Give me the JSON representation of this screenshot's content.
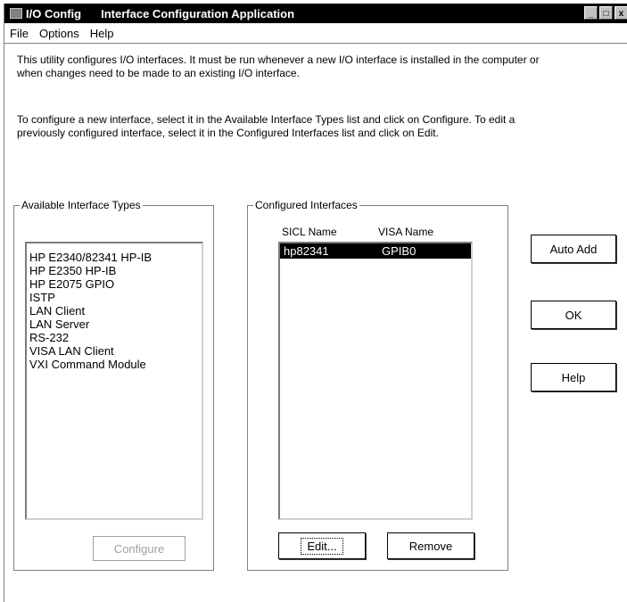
{
  "window": {
    "title_app": "I/O Config",
    "title_desc": "Interface Configuration Application",
    "controls": {
      "minimize": "_",
      "maximize": "□",
      "close": "x"
    }
  },
  "menu": [
    "File",
    "Options",
    "Help"
  ],
  "description": {
    "para1": "This utility configures I/O interfaces.  It must be run whenever a new I/O interface is installed in the computer or when changes need to be made to an existing I/O interface.",
    "para2": "To configure a new interface, select it in the Available Interface Types list and click on Configure.  To edit a previously configured interface, select it in the Configured Interfaces list and click on Edit."
  },
  "available": {
    "label": "Available Interface Types",
    "items": [
      "HP E2340/82341 HP-IB",
      "HP E2350 HP-IB",
      "HP E2075 GPIO",
      "ISTP",
      "LAN Client",
      "LAN Server",
      "RS-232",
      "VISA LAN Client",
      "VXI Command Module"
    ],
    "configure_label": "Configure"
  },
  "configured": {
    "label": "Configured Interfaces",
    "col_sicl": "SICL Name",
    "col_visa": "VISA Name",
    "rows": [
      {
        "sicl": "hp82341",
        "visa": "GPIB0"
      }
    ],
    "edit_label": "Edit...",
    "remove_label": "Remove"
  },
  "buttons": {
    "auto_add": "Auto Add",
    "ok": "OK",
    "help": "Help"
  }
}
